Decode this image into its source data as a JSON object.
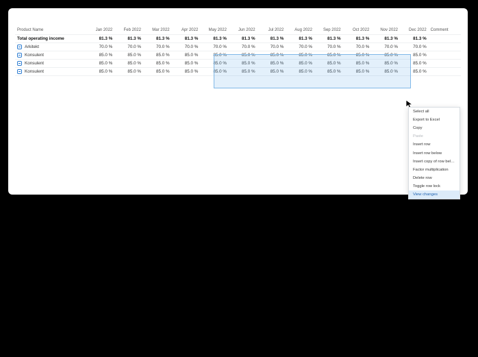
{
  "columns": {
    "product_name": "Product Name",
    "months": [
      "Jan 2022",
      "Feb 2022",
      "Mar 2022",
      "Apr 2022",
      "May 2022",
      "Jun 2022",
      "Jul 2022",
      "Aug 2022",
      "Sep 2022",
      "Oct 2022",
      "Nov 2022",
      "Dec 2022"
    ],
    "comment": "Comment"
  },
  "total_row": {
    "label": "Total operating income",
    "values": [
      "81.3 %",
      "81.3 %",
      "81.3 %",
      "81.3 %",
      "81.3 %",
      "81.3 %",
      "81.3 %",
      "81.3 %",
      "81.3 %",
      "81.3 %",
      "81.3 %",
      "81.3 %"
    ]
  },
  "rows": [
    {
      "name": "Arkitekt",
      "values": [
        "70.0 %",
        "70.0 %",
        "70.0 %",
        "70.0 %",
        "70.0 %",
        "70.0 %",
        "70.0 %",
        "70.0 %",
        "70.0 %",
        "70.0 %",
        "70.0 %",
        "70.0 %"
      ]
    },
    {
      "name": "Konsulent",
      "values": [
        "85.0 %",
        "85.0 %",
        "85.0 %",
        "85.0 %",
        "85.0 %",
        "85.0 %",
        "85.0 %",
        "85.0 %",
        "85.0 %",
        "85.0 %",
        "85.0 %",
        "85.0 %"
      ]
    },
    {
      "name": "Konsulent",
      "values": [
        "85.0 %",
        "85.0 %",
        "85.0 %",
        "85.0 %",
        "85.0 %",
        "85.0 %",
        "85.0 %",
        "85.0 %",
        "85.0 %",
        "85.0 %",
        "85.0 %",
        "85.0 %"
      ]
    },
    {
      "name": "Konsulent",
      "values": [
        "85.0 %",
        "85.0 %",
        "85.0 %",
        "85.0 %",
        "85.0 %",
        "85.0 %",
        "85.0 %",
        "85.0 %",
        "85.0 %",
        "85.0 %",
        "85.0 %",
        "85.0 %"
      ]
    }
  ],
  "context_menu": {
    "items": [
      {
        "label": "Select all",
        "disabled": false,
        "highlight": false
      },
      {
        "label": "Export to Excel",
        "disabled": false,
        "highlight": false
      },
      {
        "label": "Copy",
        "disabled": false,
        "highlight": false
      },
      {
        "label": "Paste",
        "disabled": true,
        "highlight": false
      },
      {
        "label": "Insert row",
        "disabled": false,
        "highlight": false
      },
      {
        "label": "Insert row below",
        "disabled": false,
        "highlight": false
      },
      {
        "label": "Insert copy of row below",
        "disabled": false,
        "highlight": false
      },
      {
        "label": "Factor multiplication",
        "disabled": false,
        "highlight": false
      },
      {
        "label": "Delete row",
        "disabled": false,
        "highlight": false
      },
      {
        "label": "Toggle row lock",
        "disabled": false,
        "highlight": false
      },
      {
        "label": "View changes",
        "disabled": false,
        "highlight": true
      }
    ]
  }
}
